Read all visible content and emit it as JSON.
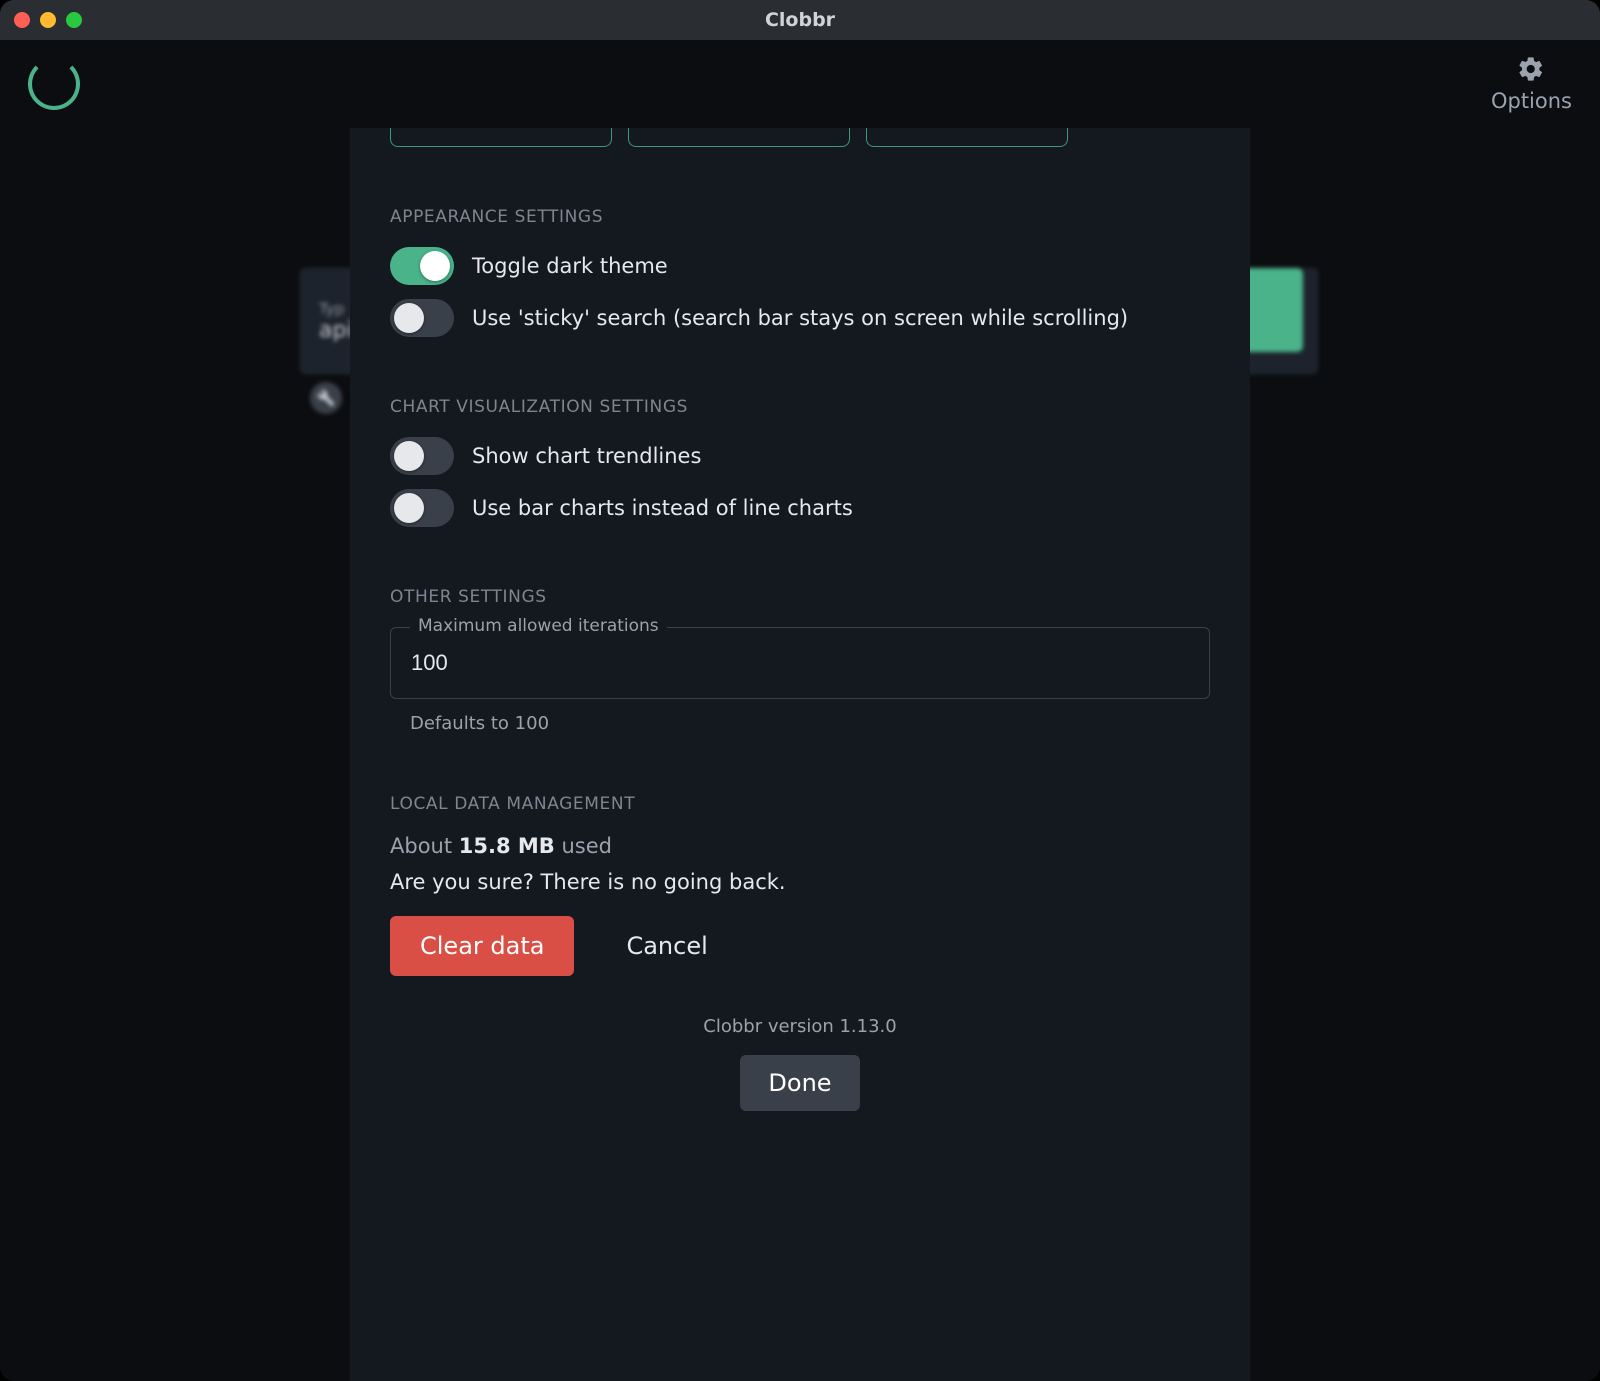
{
  "window": {
    "title": "Clobbr"
  },
  "header": {
    "options_label": "Options"
  },
  "background": {
    "search_placeholder_line1": "Typ",
    "search_placeholder_line2": "api"
  },
  "modal": {
    "sections": {
      "appearance": {
        "heading": "APPEARANCE SETTINGS",
        "dark_theme": {
          "label": "Toggle dark theme",
          "value": true
        },
        "sticky_search": {
          "label": "Use 'sticky' search (search bar stays on screen while scrolling)",
          "value": false
        }
      },
      "chart": {
        "heading": "CHART VISUALIZATION SETTINGS",
        "trendlines": {
          "label": "Show chart trendlines",
          "value": false
        },
        "bar_charts": {
          "label": "Use bar charts instead of line charts",
          "value": false
        }
      },
      "other": {
        "heading": "OTHER SETTINGS",
        "max_iter": {
          "label": "Maximum allowed iterations",
          "value": "100",
          "helper": "Defaults to 100"
        }
      },
      "local_data": {
        "heading": "LOCAL DATA MANAGEMENT",
        "storage_prefix": "About ",
        "storage_amount": "15.8 MB",
        "storage_suffix": " used",
        "confirm_text": "Are you sure? There is no going back.",
        "clear_label": "Clear data",
        "cancel_label": "Cancel"
      }
    },
    "version": "Clobbr version 1.13.0",
    "done_label": "Done"
  }
}
